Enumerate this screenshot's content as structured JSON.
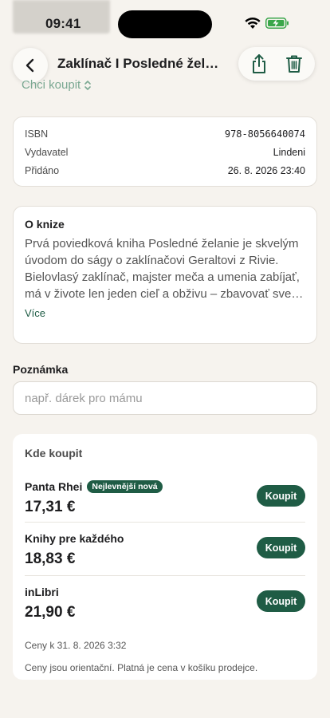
{
  "status_bar": {
    "time": "09:41"
  },
  "nav": {
    "title": "Zaklínač I Posledné želanie",
    "back_icon": "chevron-left-icon",
    "share_icon": "share-icon",
    "delete_icon": "trash-icon"
  },
  "status_select": {
    "value": "Chci koupit"
  },
  "info": {
    "rows": [
      {
        "key": "ISBN",
        "value": "978-8056640074"
      },
      {
        "key": "Vydavatel",
        "value": "Lindeni"
      },
      {
        "key": "Přidáno",
        "value": "26. 8. 2026 23:40"
      }
    ]
  },
  "about": {
    "title": "O knize",
    "text": "Prvá poviedková kniha Posledné želanie je skvelým úvodom do ságy o zaklínačovi Geraltovi z Rivie. Bielovlasý zaklínač, majster meča a umenia zabíjať, má v živote len jeden cieľ a obživu – zbavovať svet príšer. Odveké zaklínačské umenie chráni ľudstvo pred netvormi…",
    "more": "Více"
  },
  "note": {
    "label": "Poznámka",
    "placeholder": "např. dárek pro mámu",
    "value": ""
  },
  "buy": {
    "header": "Kde koupit",
    "stores": [
      {
        "name": "Panta Rhei",
        "badge": "Nejlevnější nová",
        "price": "17,31 €",
        "button": "Koupit"
      },
      {
        "name": "Knihy pre každého",
        "badge": "",
        "price": "18,83 €",
        "button": "Koupit"
      },
      {
        "name": "inLibri",
        "badge": "",
        "price": "21,90 €",
        "button": "Koupit"
      }
    ],
    "prices_date": "Ceny k 31. 8. 2026 3:32",
    "prices_note": "Ceny jsou orientační. Platná je cena v košíku prodejce."
  },
  "colors": {
    "accent": "#1f5c45",
    "background": "#f6f3ee",
    "status_select": "#7aa892"
  }
}
